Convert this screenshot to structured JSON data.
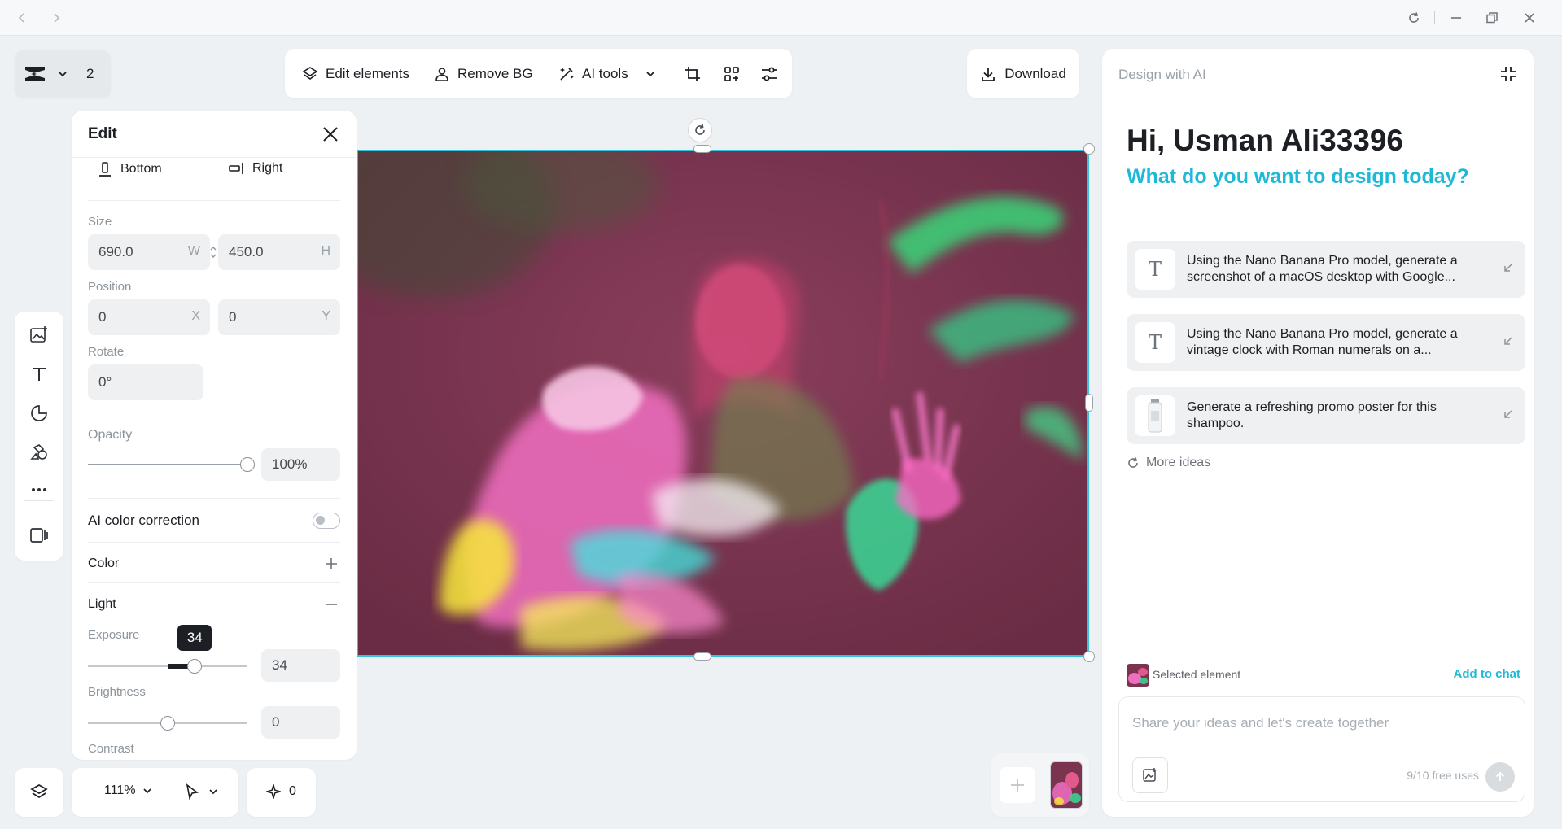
{
  "project": {
    "count": "2"
  },
  "toolbar": {
    "edit_elements": "Edit elements",
    "remove_bg": "Remove BG",
    "ai_tools": "AI tools",
    "download": "Download"
  },
  "edit_panel": {
    "title": "Edit",
    "align_bottom": "Bottom",
    "align_right": "Right",
    "size_label": "Size",
    "width": "690.0",
    "width_unit": "W",
    "height": "450.0",
    "height_unit": "H",
    "position_label": "Position",
    "x": "0",
    "x_unit": "X",
    "y": "0",
    "y_unit": "Y",
    "rotate_label": "Rotate",
    "rotate": "0°",
    "opacity_label": "Opacity",
    "opacity": "100%",
    "opacity_level": 1.0,
    "ai_color_correction": "AI color correction",
    "ai_color_correction_on": false,
    "color_label": "Color",
    "light_label": "Light",
    "exposure_label": "Exposure",
    "exposure": "34",
    "exposure_tooltip": "34",
    "exposure_level": 0.67,
    "brightness_label": "Brightness",
    "brightness": "0",
    "brightness_level": 0.5,
    "contrast_label": "Contrast"
  },
  "bottom_bar": {
    "zoom": "111%",
    "ai_count": "0"
  },
  "ai_panel": {
    "header": "Design with AI",
    "greeting": "Hi, Usman Ali33396",
    "question": "What do you want to design today?",
    "ideas": [
      {
        "text": "Using the Nano Banana Pro model, generate a screenshot of a macOS desktop with Google..."
      },
      {
        "text": "Using the Nano Banana Pro model, generate a vintage clock with Roman numerals on a..."
      },
      {
        "text": "Generate a refreshing promo poster for this shampoo."
      }
    ],
    "more_ideas": "More ideas",
    "selected_element": "Selected element",
    "add_to_chat": "Add to chat",
    "chat_placeholder": "Share your ideas and let's create together",
    "free_uses": "9/10 free uses"
  },
  "colors": {
    "accent": "#1fb9d8",
    "selection": "#35c4e0"
  }
}
